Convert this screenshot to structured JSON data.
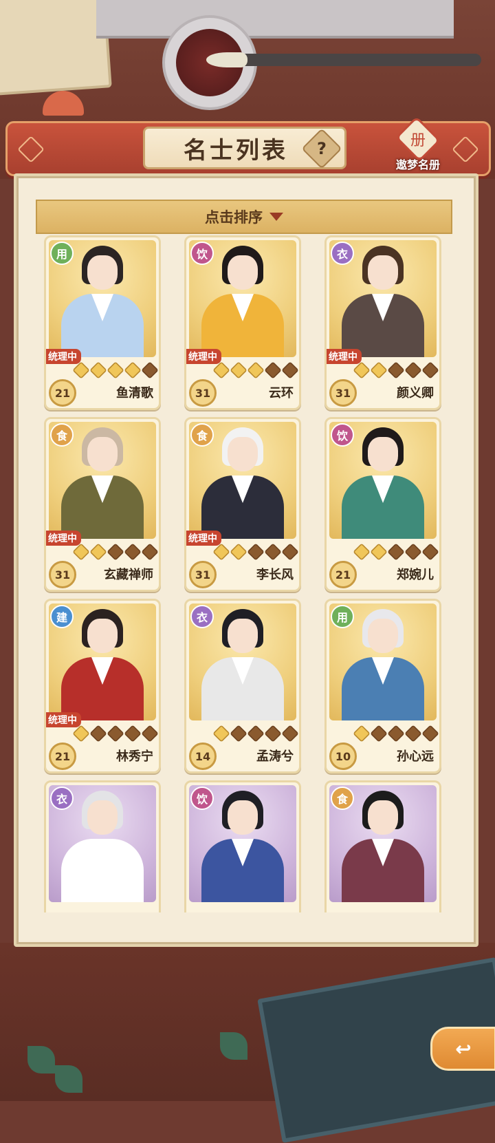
{
  "header": {
    "title": "名士列表",
    "help_label": "?",
    "dream_book_label": "遨梦名册",
    "dream_book_glyph": "册"
  },
  "sort": {
    "label": "点击排序"
  },
  "colors": {
    "badge_用": "#6fb05a",
    "badge_饮": "#c0568c",
    "badge_衣": "#9a6fc2",
    "badge_食": "#e0a24a",
    "badge_建": "#4a8fd0",
    "status": "#c7452f"
  },
  "cards": [
    {
      "type": "用",
      "status": "统理中",
      "stars_on": 4,
      "level": "21",
      "name": "鱼清歌",
      "bg": "gold",
      "hair": "#2b2524",
      "robe": "#b9d3ef"
    },
    {
      "type": "饮",
      "status": "统理中",
      "stars_on": 3,
      "level": "31",
      "name": "云环",
      "bg": "gold",
      "hair": "#1f1a1a",
      "robe": "#f0b43a"
    },
    {
      "type": "衣",
      "status": "统理中",
      "stars_on": 2,
      "level": "31",
      "name": "颜义卿",
      "bg": "gold",
      "hair": "#4a3323",
      "robe": "#5a4a45"
    },
    {
      "type": "食",
      "status": "统理中",
      "stars_on": 2,
      "level": "31",
      "name": "玄藏禅师",
      "bg": "gold",
      "hair": "#cbb8a3",
      "robe": "#6f6a3a"
    },
    {
      "type": "食",
      "status": "统理中",
      "stars_on": 2,
      "level": "31",
      "name": "李长风",
      "bg": "gold",
      "hair": "#f2f2f2",
      "robe": "#2c2d3a"
    },
    {
      "type": "饮",
      "status": "",
      "stars_on": 2,
      "level": "21",
      "name": "郑婉儿",
      "bg": "gold",
      "hair": "#1f1a1a",
      "robe": "#3f8b7a"
    },
    {
      "type": "建",
      "status": "统理中",
      "stars_on": 1,
      "level": "21",
      "name": "林秀宁",
      "bg": "gold",
      "hair": "#2b2220",
      "robe": "#b72f2a"
    },
    {
      "type": "衣",
      "status": "",
      "stars_on": 1,
      "level": "14",
      "name": "孟涛兮",
      "bg": "gold",
      "hair": "#1f1f25",
      "robe": "#e8e8e8"
    },
    {
      "type": "用",
      "status": "",
      "stars_on": 1,
      "level": "10",
      "name": "孙心远",
      "bg": "gold",
      "hair": "#e8e8ec",
      "robe": "#4b7fb3"
    },
    {
      "type": "衣",
      "status": "",
      "stars_on": 0,
      "level": "",
      "name": "",
      "bg": "purple",
      "hair": "#e3e3e6",
      "robe": "#ffffff"
    },
    {
      "type": "饮",
      "status": "",
      "stars_on": 0,
      "level": "",
      "name": "",
      "bg": "purple",
      "hair": "#1f1f25",
      "robe": "#3c55a0"
    },
    {
      "type": "食",
      "status": "",
      "stars_on": 0,
      "level": "",
      "name": "",
      "bg": "purple",
      "hair": "#1c1c1c",
      "robe": "#7a3a4a"
    }
  ],
  "back_button": {
    "glyph": "↩"
  }
}
